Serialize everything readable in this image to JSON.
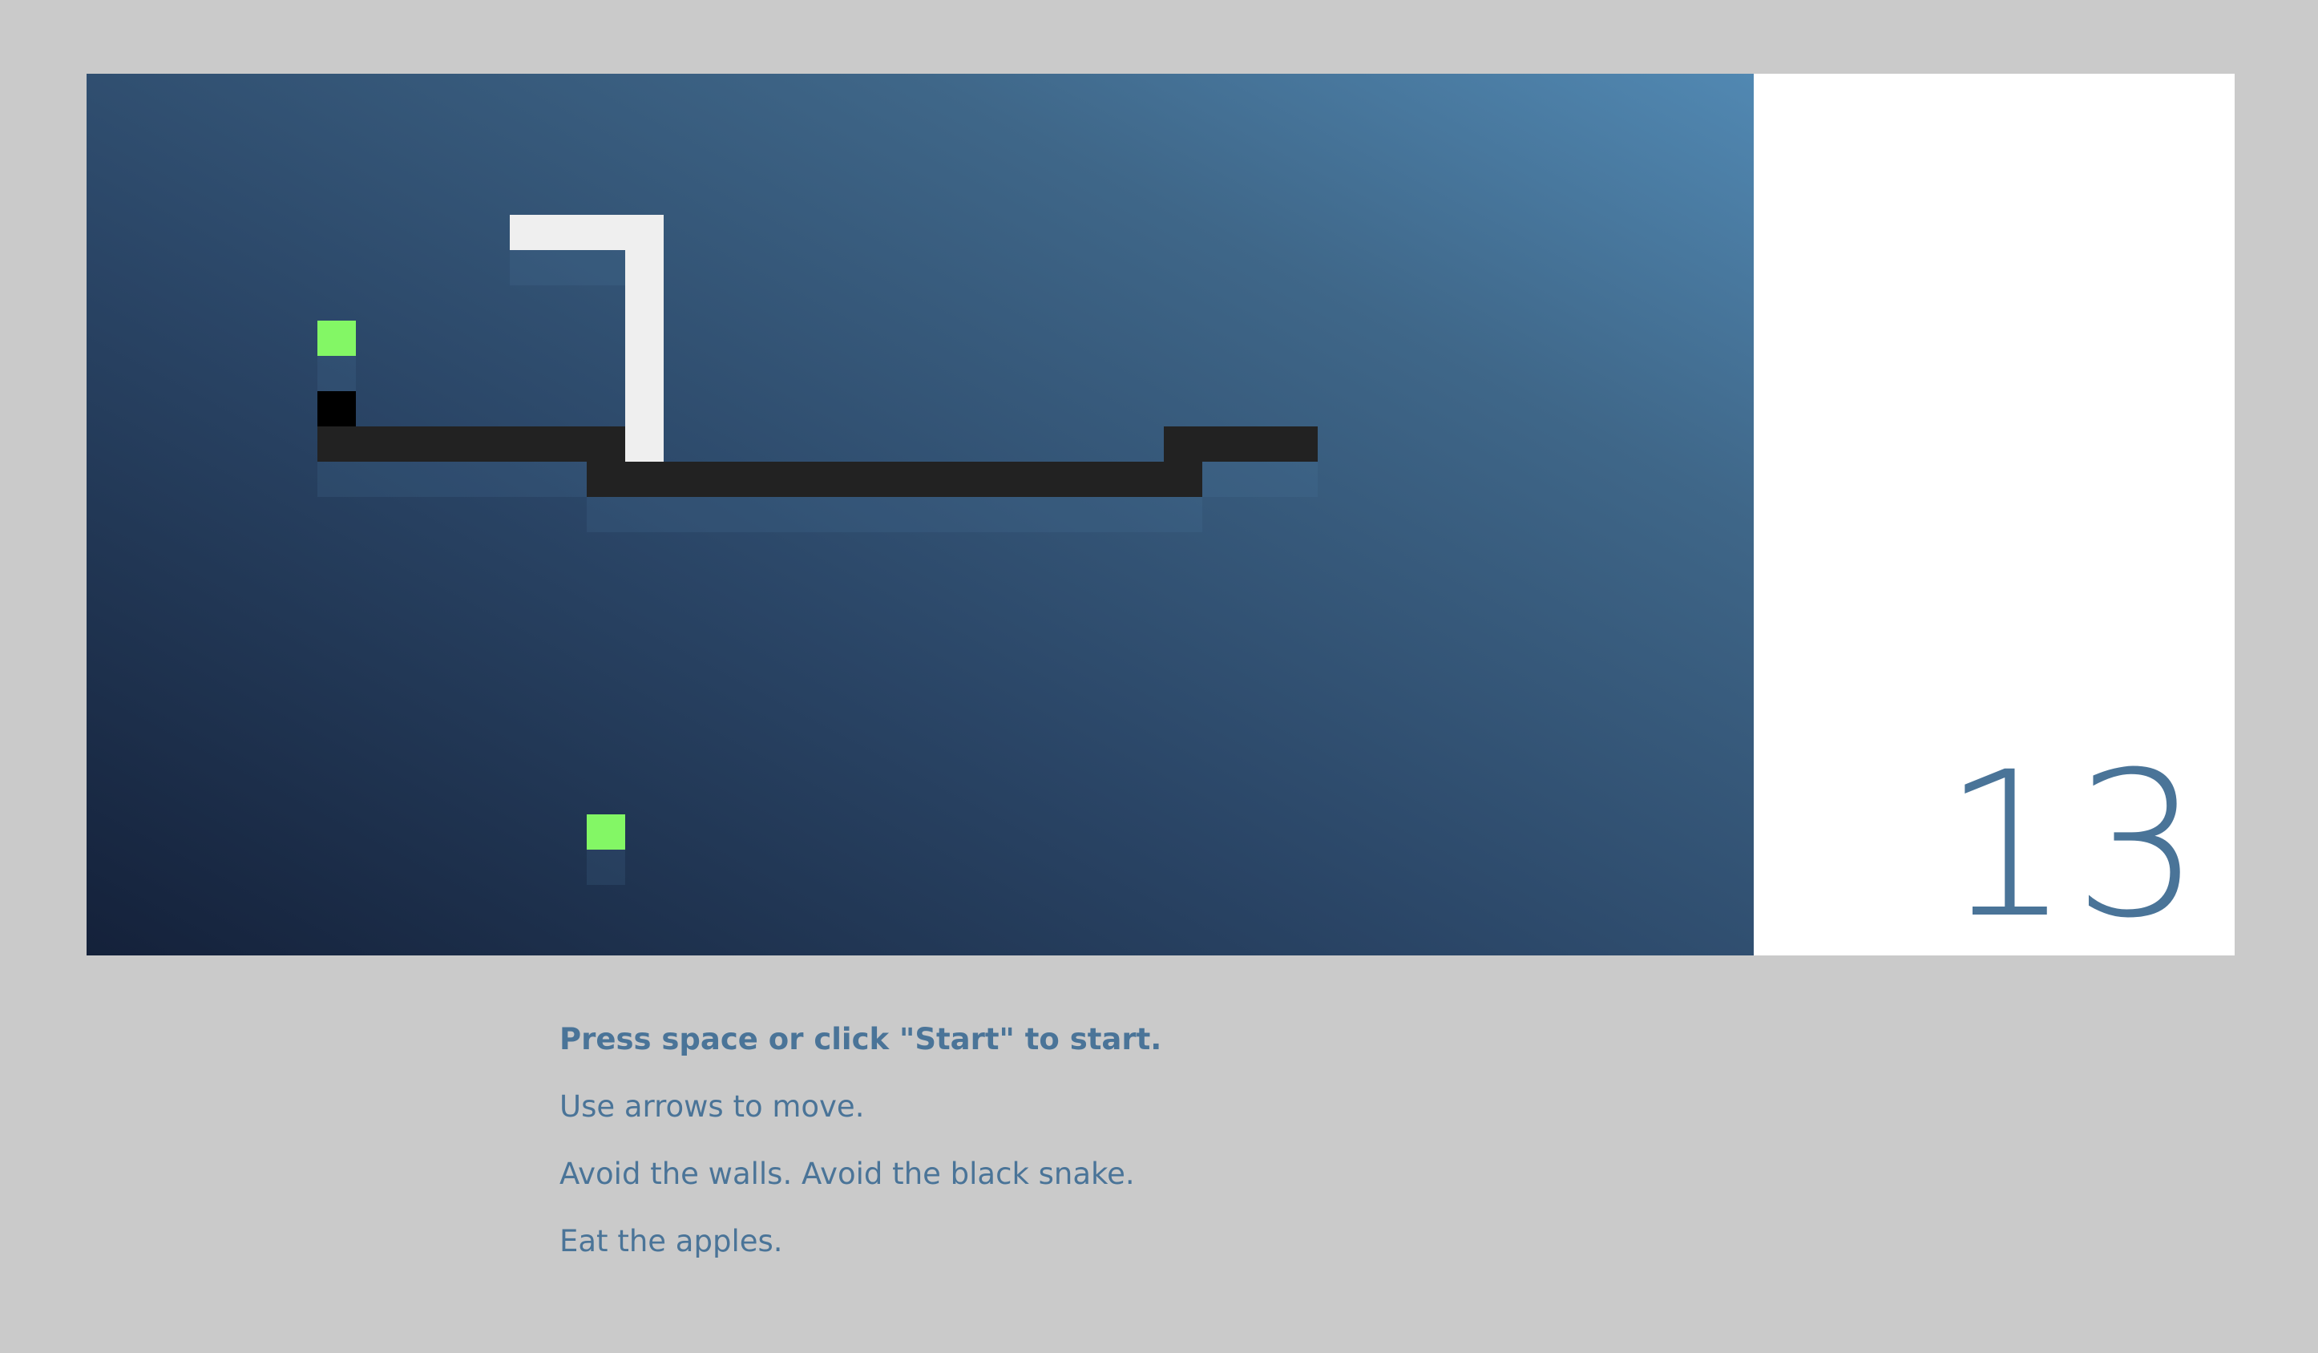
{
  "score": {
    "value": "13"
  },
  "board": {
    "cols": 43,
    "rows": 25,
    "colors": {
      "player_snake": "#efefef",
      "player_head": "#ffffff",
      "enemy_snake": "#222222",
      "enemy_head": "#000000",
      "apple": "#83f765",
      "score_text": "#4a7498",
      "page_background": "#cacaca"
    },
    "player_snake": [
      [
        4,
        11
      ],
      [
        4,
        12
      ],
      [
        4,
        13
      ],
      [
        4,
        14
      ],
      [
        5,
        14
      ],
      [
        6,
        14
      ],
      [
        7,
        14
      ],
      [
        8,
        14
      ],
      [
        9,
        14
      ],
      [
        10,
        14
      ],
      [
        11,
        15
      ],
      [
        11,
        16
      ],
      [
        11,
        17
      ],
      [
        11,
        18
      ],
      [
        11,
        19
      ]
    ],
    "player_head": [
      11,
      19
    ],
    "enemy_snake": [
      [
        9,
        6
      ],
      [
        10,
        6
      ],
      [
        10,
        7
      ],
      [
        10,
        8
      ],
      [
        10,
        9
      ],
      [
        10,
        10
      ],
      [
        10,
        11
      ],
      [
        10,
        12
      ],
      [
        10,
        13
      ],
      [
        11,
        13
      ],
      [
        11,
        14
      ],
      [
        11,
        15
      ],
      [
        11,
        16
      ],
      [
        11,
        17
      ],
      [
        11,
        18
      ],
      [
        11,
        19
      ],
      [
        11,
        20
      ],
      [
        11,
        21
      ],
      [
        11,
        22
      ],
      [
        11,
        23
      ],
      [
        11,
        24
      ],
      [
        11,
        25
      ],
      [
        11,
        26
      ],
      [
        11,
        27
      ],
      [
        11,
        28
      ],
      [
        10,
        28
      ],
      [
        10,
        29
      ],
      [
        10,
        30
      ],
      [
        10,
        31
      ]
    ],
    "enemy_head": [
      9,
      6
    ],
    "apples": [
      [
        7,
        6
      ],
      [
        21,
        13
      ]
    ]
  },
  "instructions": [
    {
      "text": "Press space or click \"Start\" to start.",
      "bold": true
    },
    {
      "text": "Use arrows to move.",
      "bold": false
    },
    {
      "text": "Avoid the walls. Avoid the black snake.",
      "bold": false
    },
    {
      "text": "Eat the apples.",
      "bold": false
    }
  ]
}
